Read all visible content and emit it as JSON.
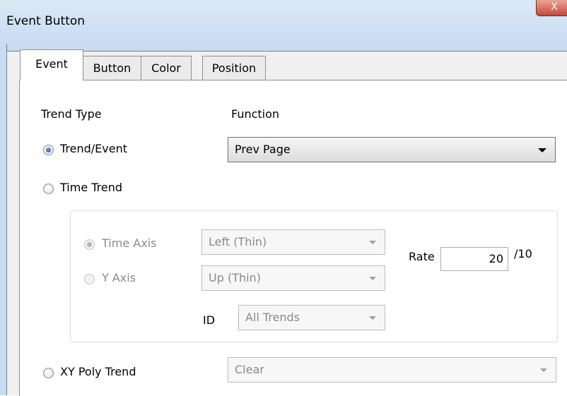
{
  "window": {
    "title": "Event Button",
    "close_glyph": "X"
  },
  "tabs": [
    {
      "label": "Event"
    },
    {
      "label": "Button"
    },
    {
      "label": "Color"
    },
    {
      "label": "Position"
    }
  ],
  "event": {
    "trend_type_label": "Trend Type",
    "function_label": "Function",
    "options": {
      "trend_event": {
        "label": "Trend/Event",
        "checked": true
      },
      "time_trend": {
        "label": "Time Trend",
        "checked": false
      },
      "xy_poly_trend": {
        "label": "XY Poly Trend",
        "checked": false
      }
    },
    "function_select": {
      "value": "Prev Page"
    },
    "time_trend_group": {
      "time_axis": {
        "label": "Time Axis",
        "checked": true,
        "value": "Left (Thin)"
      },
      "y_axis": {
        "label": "Y Axis",
        "checked": false,
        "value": "Up (Thin)"
      },
      "id": {
        "label": "ID",
        "value": "All Trends"
      },
      "rate": {
        "label": "Rate",
        "value": "20",
        "unit": "/10"
      }
    },
    "xy_select": {
      "value": "Clear"
    }
  }
}
